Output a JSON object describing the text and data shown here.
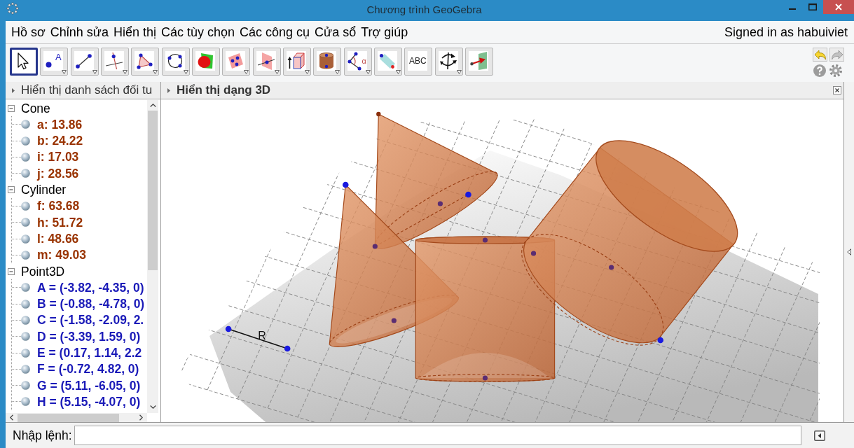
{
  "window": {
    "title": "Chương trình GeoGebra"
  },
  "menu": [
    "Hồ sơ",
    "Chỉnh sửa",
    "Hiển thị",
    "Các tùy chọn",
    "Các công cụ",
    "Cửa sổ",
    "Trợ giúp"
  ],
  "account": "Signed in as habuiviet",
  "toolbar": {
    "tools": [
      {
        "kind": "move",
        "selected": true,
        "has_submenu": false
      },
      {
        "kind": "point",
        "label": "A",
        "selected": false,
        "has_submenu": true
      },
      {
        "kind": "segment",
        "selected": false,
        "has_submenu": true
      },
      {
        "kind": "perpendicular",
        "selected": false,
        "has_submenu": true
      },
      {
        "kind": "polygon",
        "selected": false,
        "has_submenu": true
      },
      {
        "kind": "circle",
        "selected": false,
        "has_submenu": true
      },
      {
        "kind": "intersect",
        "selected": false,
        "has_submenu": false
      },
      {
        "kind": "plane_points",
        "selected": false,
        "has_submenu": true
      },
      {
        "kind": "plane",
        "selected": false,
        "has_submenu": true
      },
      {
        "kind": "prism",
        "selected": false,
        "has_submenu": true
      },
      {
        "kind": "cylinder",
        "selected": false,
        "has_submenu": true
      },
      {
        "kind": "angle",
        "label": "α",
        "selected": false,
        "has_submenu": true
      },
      {
        "kind": "reflect",
        "selected": false,
        "has_submenu": true
      },
      {
        "kind": "text",
        "label": "ABC",
        "selected": false,
        "has_submenu": false
      },
      {
        "kind": "rotate",
        "selected": false,
        "has_submenu": true
      },
      {
        "kind": "view",
        "selected": false,
        "has_submenu": false
      }
    ],
    "undo": {
      "disabled": false
    },
    "redo": {
      "disabled": true
    }
  },
  "algebra_view": {
    "title": "Hiển thị danh sách đối tu",
    "groups": [
      {
        "name": "Cone",
        "expanded": true,
        "items": [
          {
            "text": "a: 13.86",
            "color": "#993300",
            "visible": true
          },
          {
            "text": "b: 24.22",
            "color": "#993300",
            "visible": true
          },
          {
            "text": "i: 17.03",
            "color": "#993300",
            "visible": true
          },
          {
            "text": "j: 28.56",
            "color": "#993300",
            "visible": true
          }
        ]
      },
      {
        "name": "Cylinder",
        "expanded": true,
        "items": [
          {
            "text": "f: 63.68",
            "color": "#993300",
            "visible": true
          },
          {
            "text": "h: 51.72",
            "color": "#993300",
            "visible": true
          },
          {
            "text": "l: 48.66",
            "color": "#993300",
            "visible": true
          },
          {
            "text": "m: 49.03",
            "color": "#993300",
            "visible": true
          }
        ]
      },
      {
        "name": "Point3D",
        "expanded": true,
        "items": [
          {
            "text": "A = (-3.82, -4.35, 0)",
            "color": "#1a1ab8",
            "visible": true
          },
          {
            "text": "B = (-0.88, -4.78, 0)",
            "color": "#1a1ab8",
            "visible": true
          },
          {
            "text": "C = (-1.58, -2.09, 2.",
            "color": "#1a1ab8",
            "visible": true
          },
          {
            "text": "D = (-3.39, 1.59, 0)",
            "color": "#1a1ab8",
            "visible": true
          },
          {
            "text": "E = (0.17, 1.14, 2.2",
            "color": "#1a1ab8",
            "visible": true
          },
          {
            "text": "F = (-0.72, 4.82, 0)",
            "color": "#1a1ab8",
            "visible": true
          },
          {
            "text": "G = (5.11, -6.05, 0)",
            "color": "#1a1ab8",
            "visible": true
          },
          {
            "text": "H = (5.15, -4.07, 0)",
            "color": "#1a1ab8",
            "visible": true
          }
        ]
      }
    ]
  },
  "graphics_3d": {
    "title": "Hiển thị dạng 3D",
    "segment_label": "R"
  },
  "input_bar": {
    "label": "Nhập lệnh:"
  }
}
